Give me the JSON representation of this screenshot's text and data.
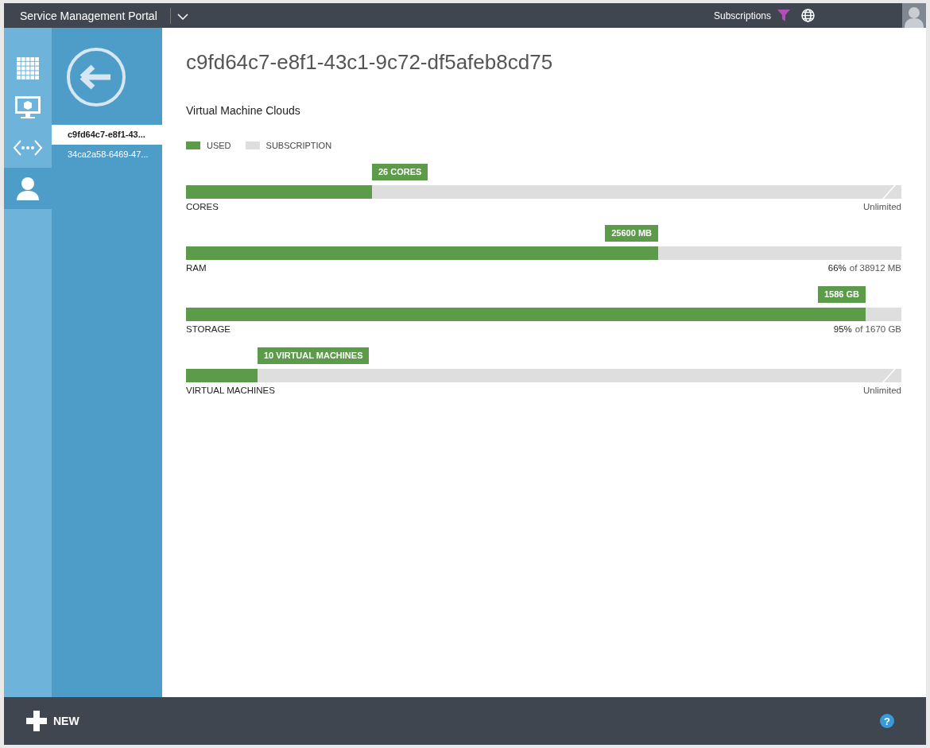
{
  "top_bar": {
    "title": "Service Management Portal",
    "subscriptions_label": "Subscriptions"
  },
  "rail": [
    {
      "kind": "grid",
      "selected": false
    },
    {
      "kind": "monitor",
      "selected": false
    },
    {
      "kind": "code",
      "selected": false
    },
    {
      "kind": "person",
      "selected": true
    }
  ],
  "nav": {
    "items": [
      {
        "label": "c9fd64c7-e8f1-43...",
        "selected": true
      },
      {
        "label": "34ca2a58-6469-47...",
        "selected": false
      }
    ]
  },
  "page": {
    "title": "c9fd64c7-e8f1-43c1-9c72-df5afeb8cd75",
    "section": "Virtual Machine Clouds",
    "legend": [
      {
        "label": "USED",
        "color": "#5c9b4a"
      },
      {
        "label": "SUBSCRIPTION",
        "color": "#dedede"
      }
    ],
    "meters": [
      {
        "name": "CORES",
        "kind": "unlimited",
        "tag": "26 CORES",
        "level": 0.26,
        "reading": "Unlimited"
      },
      {
        "name": "RAM",
        "kind": "quota",
        "tag": "25600 MB",
        "level": 0.66,
        "percent": "66%",
        "reading": "of 38912 MB"
      },
      {
        "name": "STORAGE",
        "kind": "quota",
        "tag": "1586 GB",
        "level": 0.95,
        "percent": "95%",
        "reading": "of 1670 GB"
      },
      {
        "name": "VIRTUAL MACHINES",
        "kind": "unlimited",
        "tag": "10 VIRTUAL MACHINES",
        "level": 0.1,
        "reading": "Unlimited"
      }
    ]
  },
  "footer": {
    "new_label": "NEW",
    "help": "?"
  }
}
